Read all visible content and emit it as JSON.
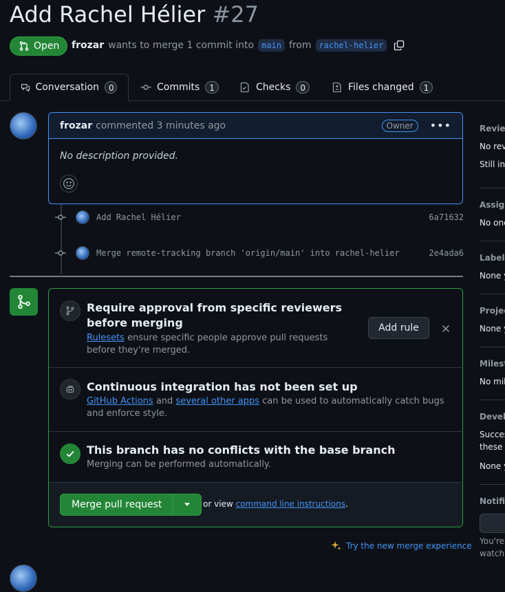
{
  "pr": {
    "title": "Add Rachel Hélier",
    "number": "#27",
    "state": "Open",
    "author": "frozar",
    "meta_text": "wants to merge 1 commit into",
    "base_branch": "main",
    "from_text": "from",
    "head_branch": "rachel-helier"
  },
  "tabs": [
    {
      "label": "Conversation",
      "count": "0",
      "icon": "comment-discussion-icon"
    },
    {
      "label": "Commits",
      "count": "1",
      "icon": "git-commit-icon"
    },
    {
      "label": "Checks",
      "count": "0",
      "icon": "checklist-icon"
    },
    {
      "label": "Files changed",
      "count": "1",
      "icon": "file-diff-icon"
    }
  ],
  "comment": {
    "author": "frozar",
    "action": "commented 3 minutes ago",
    "badge": "Owner",
    "body": "No description provided."
  },
  "commits": [
    {
      "message": "Add Rachel Hélier",
      "sha": "6a71632"
    },
    {
      "message": "Merge remote-tracking branch 'origin/main' into rachel-helier",
      "sha": "2e4ada6"
    }
  ],
  "merge_box": {
    "rules": {
      "title": "Require approval from specific reviewers before merging",
      "desc_link": "Rulesets",
      "desc": "ensure specific people approve pull requests before they're merged.",
      "button": "Add rule"
    },
    "ci": {
      "title": "Continuous integration has not been set up",
      "link1": "GitHub Actions",
      "and": "and",
      "link2": "several other apps",
      "desc": "can be used to automatically catch bugs and enforce style."
    },
    "conflicts": {
      "title": "This branch has no conflicts with the base branch",
      "desc": "Merging can be performed automatically."
    },
    "merge_button": "Merge pull request",
    "or_view": "or view",
    "cli_link": "command line instructions",
    "period": "."
  },
  "try_new": "Try the new merge experience",
  "sidebar": [
    {
      "label": "Review",
      "values": [
        "No rev",
        "Still in"
      ]
    },
    {
      "label": "Assign",
      "values": [
        "No one"
      ]
    },
    {
      "label": "Labels",
      "values": [
        "None y"
      ]
    },
    {
      "label": "Projec",
      "values": [
        "None y"
      ]
    },
    {
      "label": "Milest",
      "values": [
        "No mil"
      ]
    },
    {
      "label": "Develo",
      "values": [
        "Succes",
        "these i",
        "None y"
      ]
    },
    {
      "label": "Notific",
      "values": [
        "You're",
        "watchi"
      ]
    }
  ],
  "colors": {
    "background": "#0d1117",
    "accent_blue": "#4493f8",
    "success_green": "#238636",
    "border": "#30363d",
    "muted_text": "#9198a1"
  }
}
